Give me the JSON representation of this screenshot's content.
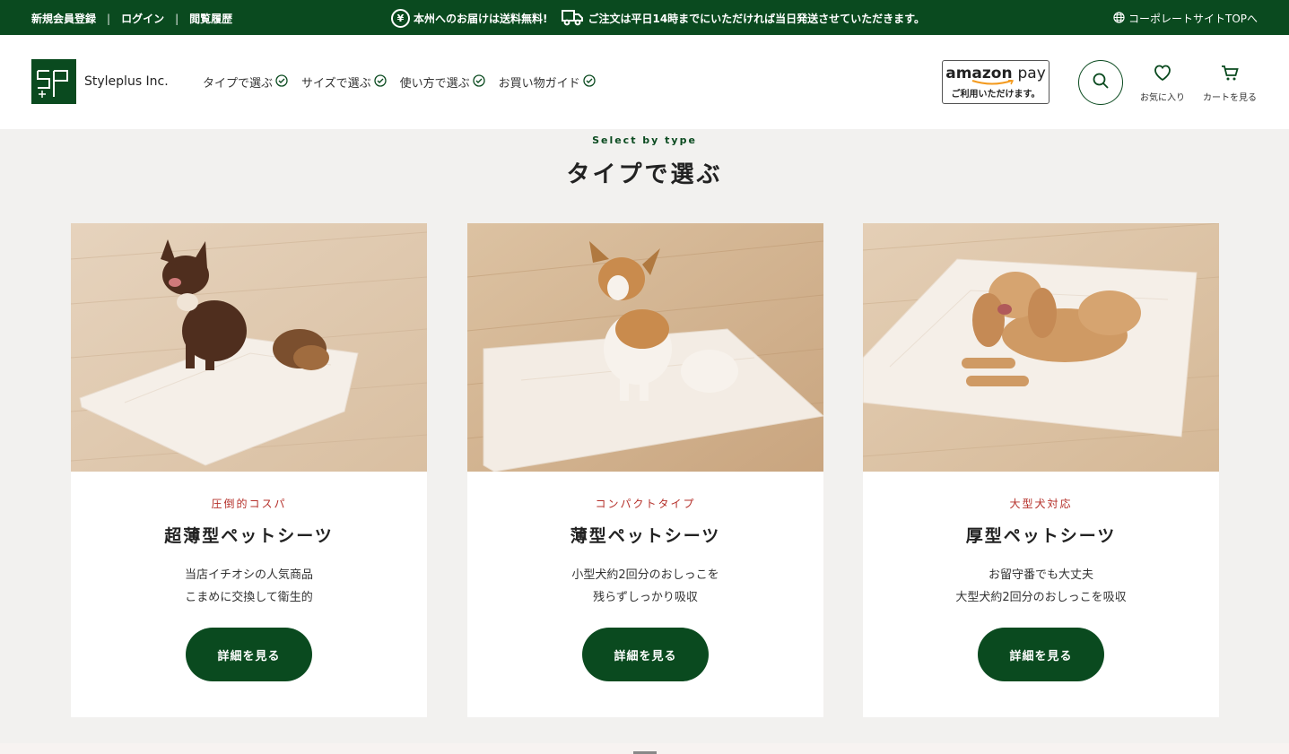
{
  "topbar": {
    "links": [
      "新規会員登録",
      "ログイン",
      "閲覧履歴"
    ],
    "separator": "|",
    "yen_glyph": "¥",
    "free_shipping": "本州へのお届けは送料無料!",
    "same_day": "ご注文は平日14時までにいただければ当日発送させていただきます。",
    "corporate": "コーポレートサイトTOPへ",
    "icons": [
      "yen-icon",
      "truck-icon",
      "globe-icon"
    ]
  },
  "header": {
    "logo_text": "Styleplus Inc.",
    "nav": [
      "タイプで選ぶ",
      "サイズで選ぶ",
      "使い方で選ぶ",
      "お買い物ガイド"
    ],
    "amazon_pay": {
      "brand": "amazon",
      "pay": "pay",
      "sub": "ご利用いただけます。"
    },
    "favorites_label": "お気に入り",
    "cart_label": "カートを見る",
    "icons": [
      "search-icon",
      "heart-icon",
      "cart-icon",
      "check-circle-icon"
    ]
  },
  "section": {
    "subtitle": "Select by type",
    "title": "タイプで選ぶ"
  },
  "cards": [
    {
      "tag": "圧倒的コスパ",
      "name": "超薄型ペットシーツ",
      "desc1": "当店イチオシの人気商品",
      "desc2": "こまめに交換して衛生的",
      "button": "詳細を見る"
    },
    {
      "tag": "コンパクトタイプ",
      "name": "薄型ペットシーツ",
      "desc1": "小型犬約2回分のおしっこを",
      "desc2": "残らずしっかり吸収",
      "button": "詳細を見る"
    },
    {
      "tag": "大型犬対応",
      "name": "厚型ペットシーツ",
      "desc1": "お留守番でも大丈夫",
      "desc2": "大型犬約2回分のおしっこを吸収",
      "button": "詳細を見る"
    }
  ],
  "colors": {
    "brand_green": "#0a4a1f",
    "tag_red": "#b5302a",
    "page_bg": "#f2f1ef"
  }
}
